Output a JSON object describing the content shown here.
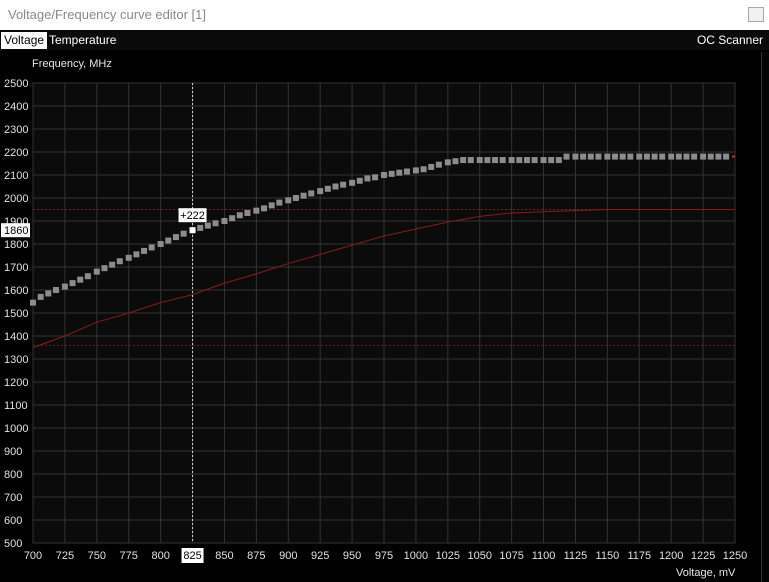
{
  "window": {
    "title": "Voltage/Frequency curve editor [1]"
  },
  "tabs": [
    {
      "label": "Voltage",
      "active": true
    },
    {
      "label": "Temperature",
      "active": false
    }
  ],
  "toolbar": {
    "oc_scanner_label": "OC Scanner"
  },
  "colors": {
    "background": "#000000",
    "grid": "#333333",
    "curve_points": "#8c8c8c",
    "selected_point": "#ffffff",
    "base_curve": "#8b1a1a",
    "guide_line": "#7a2020"
  },
  "chart_data": {
    "type": "line",
    "ylabel": "Frequency, MHz",
    "xlabel": "Voltage, mV",
    "xlim": [
      700,
      1250
    ],
    "ylim": [
      500,
      2500
    ],
    "x_ticks": [
      700,
      725,
      750,
      775,
      800,
      825,
      850,
      875,
      900,
      925,
      950,
      975,
      1000,
      1025,
      1050,
      1075,
      1100,
      1125,
      1150,
      1175,
      1200,
      1225,
      1250
    ],
    "y_ticks": [
      2500,
      2400,
      2300,
      2200,
      2100,
      2000,
      1900,
      1800,
      1700,
      1600,
      1500,
      1400,
      1300,
      1200,
      1100,
      1000,
      900,
      800,
      700,
      600,
      500
    ],
    "grid": true,
    "selected": {
      "voltage": "825",
      "frequency": "1860",
      "offset": "+222"
    },
    "series": [
      {
        "kind": "curve_points",
        "x": [
          700,
          706,
          712,
          718,
          725,
          731,
          737,
          743,
          750,
          756,
          762,
          768,
          775,
          781,
          787,
          793,
          800,
          806,
          812,
          818,
          825,
          831,
          837,
          843,
          850,
          856,
          862,
          868,
          875,
          881,
          887,
          893,
          900,
          906,
          912,
          918,
          925,
          931,
          937,
          943,
          950,
          956,
          962,
          968,
          975,
          981,
          987,
          993,
          1000,
          1006,
          1012,
          1018,
          1025,
          1031,
          1037,
          1043,
          1050,
          1056,
          1062,
          1068,
          1075,
          1081,
          1087,
          1093,
          1100,
          1106,
          1112,
          1118,
          1125,
          1131,
          1137,
          1143,
          1150,
          1156,
          1162,
          1168,
          1175,
          1181,
          1187,
          1193,
          1200,
          1206,
          1212,
          1218,
          1225,
          1231,
          1237,
          1243
        ],
        "y": [
          1545,
          1570,
          1585,
          1600,
          1615,
          1630,
          1645,
          1660,
          1680,
          1695,
          1710,
          1725,
          1740,
          1755,
          1770,
          1785,
          1800,
          1815,
          1830,
          1845,
          1860,
          1870,
          1880,
          1890,
          1900,
          1912,
          1925,
          1935,
          1945,
          1955,
          1968,
          1980,
          1990,
          2000,
          2010,
          2020,
          2030,
          2040,
          2050,
          2058,
          2066,
          2075,
          2085,
          2090,
          2100,
          2105,
          2110,
          2115,
          2120,
          2125,
          2135,
          2145,
          2155,
          2160,
          2165,
          2165,
          2165,
          2165,
          2165,
          2165,
          2165,
          2165,
          2165,
          2165,
          2165,
          2165,
          2165,
          2180,
          2180,
          2180,
          2180,
          2180,
          2180,
          2180,
          2180,
          2180,
          2180,
          2180,
          2180,
          2180,
          2180,
          2180,
          2180,
          2180,
          2180,
          2180,
          2180,
          2180
        ]
      },
      {
        "kind": "base_curve",
        "x": [
          700,
          725,
          750,
          775,
          800,
          825,
          850,
          875,
          900,
          925,
          950,
          975,
          1000,
          1025,
          1050,
          1075,
          1100,
          1125,
          1150,
          1175,
          1200,
          1225,
          1250
        ],
        "y": [
          1350,
          1400,
          1460,
          1500,
          1545,
          1580,
          1630,
          1670,
          1715,
          1755,
          1795,
          1835,
          1865,
          1895,
          1920,
          1935,
          1940,
          1945,
          1950,
          1950,
          1950,
          1950,
          1950
        ]
      }
    ],
    "guide_lines": [
      {
        "axis": "y",
        "value": 1950
      },
      {
        "axis": "y",
        "value": 1360
      }
    ],
    "end_marker": 2180
  }
}
